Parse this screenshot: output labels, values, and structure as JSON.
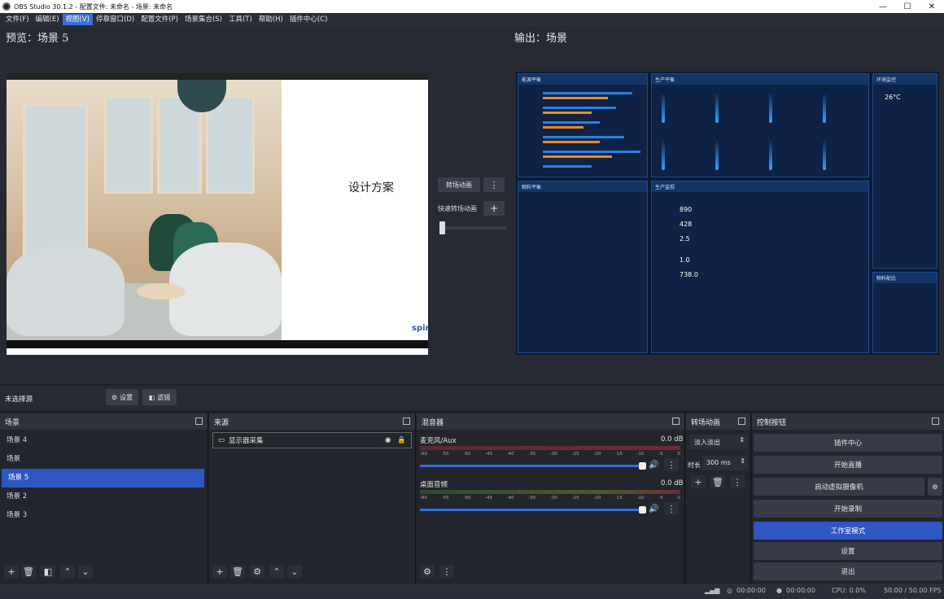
{
  "window": {
    "title": "OBS Studio 30.1.2 - 配置文件: 未命名 - 场景: 未命名",
    "controls": [
      "—",
      "☐",
      "✕"
    ]
  },
  "menu": [
    "文件(F)",
    "编辑(E)",
    "视图(V)",
    "停靠窗口(D)",
    "配置文件(P)",
    "场景集合(S)",
    "工具(T)",
    "帮助(H)",
    "插件中心(C)"
  ],
  "preview": {
    "left_label": "预览：场景 5",
    "right_label": "输出：场景",
    "slide_text": "设计方案",
    "logo_text": "spin"
  },
  "transition_controls": {
    "transition_button": "转场动画",
    "quick_label": "快速转场动画",
    "more": "⋮",
    "add": "+"
  },
  "source_status": {
    "none_selected": "未选择源",
    "settings": "设置",
    "filters": "滤镜"
  },
  "docks": {
    "scenes": {
      "title": "场景",
      "items": [
        "场景 4",
        "场景",
        "场景 5",
        "场景 2",
        "场景 3"
      ],
      "selected_index": 2
    },
    "sources": {
      "title": "来源",
      "items": [
        "显示器采集"
      ]
    },
    "mixer": {
      "title": "混音器",
      "channels": [
        {
          "name": "麦克风/Aux",
          "db": "0.0 dB"
        },
        {
          "name": "桌面音频",
          "db": "0.0 dB"
        }
      ],
      "ticks": [
        "-60",
        "-55",
        "-50",
        "-45",
        "-40",
        "-35",
        "-30",
        "-25",
        "-20",
        "-15",
        "-10",
        "-5",
        "0"
      ]
    },
    "transitions": {
      "title": "转场动画",
      "type": "淡入淡出",
      "duration_label": "时长",
      "duration": "300 ms"
    },
    "controls": {
      "title": "控制按钮",
      "buttons": [
        "插件中心",
        "开始直播",
        "启动虚拟摄像机",
        "开始录制",
        "工作室模式",
        "设置",
        "退出"
      ],
      "active": "工作室模式"
    }
  },
  "dashboard": {
    "panels": [
      "能源平衡",
      "生产平衡",
      "环境监控",
      "物料平衡",
      "生产监视",
      "物料配比"
    ],
    "temp": "26°C",
    "values": [
      "890",
      "428",
      "2.5",
      "1.0",
      "738.0"
    ]
  },
  "status": {
    "live_time": "00:00:00",
    "rec_time": "00:00:00",
    "cpu": "CPU: 0.0%",
    "fps": "50.00 / 50.00 FPS"
  },
  "colors": {
    "accent": "#2f57c2",
    "bg": "#1e1f26",
    "dock": "#23252d"
  }
}
